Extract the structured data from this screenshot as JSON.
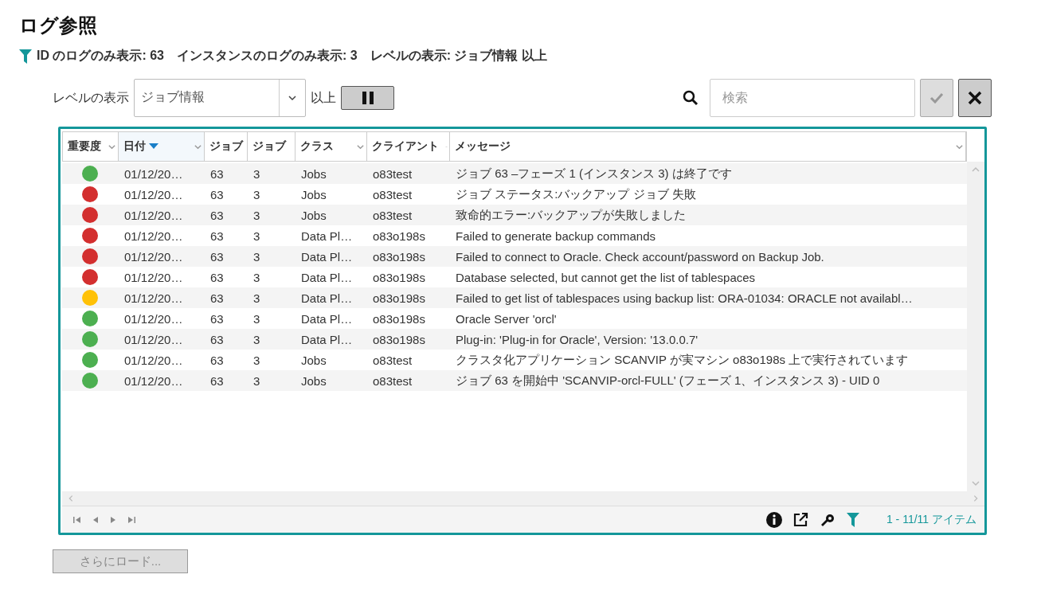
{
  "title": "ログ参照",
  "filter_summary": "ID のログのみ表示: 63　インスタンスのログのみ表示: 3　レベルの表示: ジョブ情報 以上",
  "level_filter": {
    "label": "レベルの表示",
    "value": "ジョブ情報",
    "suffix": "以上"
  },
  "search": {
    "placeholder": "検索"
  },
  "buttons": {
    "pause": {
      "disabled": false
    },
    "apply": {
      "disabled": true
    },
    "clear": {
      "disabled": false
    }
  },
  "table": {
    "columns": [
      {
        "label": "重要度",
        "sorted": false
      },
      {
        "label": "日付",
        "sorted": true
      },
      {
        "label": "ジョブ",
        "sorted": false
      },
      {
        "label": "ジョブ",
        "sorted": false
      },
      {
        "label": "クラス",
        "sorted": false
      },
      {
        "label": "クライアント",
        "sorted": false
      },
      {
        "label": "メッセージ",
        "sorted": false
      }
    ],
    "rows": [
      {
        "color": "#4caf50",
        "date": "01/12/20…",
        "job": "63",
        "instance": "3",
        "class": "Jobs",
        "client": "o83test",
        "message": "ジョブ 63 –フェーズ 1 (インスタンス 3) は終了です"
      },
      {
        "color": "#d32f2f",
        "date": "01/12/20…",
        "job": "63",
        "instance": "3",
        "class": "Jobs",
        "client": "o83test",
        "message": "ジョブ ステータス:バックアップ ジョブ 失敗"
      },
      {
        "color": "#d32f2f",
        "date": "01/12/20…",
        "job": "63",
        "instance": "3",
        "class": "Jobs",
        "client": "o83test",
        "message": "致命的エラー:バックアップが失敗しました"
      },
      {
        "color": "#d32f2f",
        "date": "01/12/20…",
        "job": "63",
        "instance": "3",
        "class": "Data Pl…",
        "client": "o83o198s",
        "message": "Failed to generate backup commands"
      },
      {
        "color": "#d32f2f",
        "date": "01/12/20…",
        "job": "63",
        "instance": "3",
        "class": "Data Pl…",
        "client": "o83o198s",
        "message": "Failed to connect to Oracle. Check account/password on Backup Job."
      },
      {
        "color": "#d32f2f",
        "date": "01/12/20…",
        "job": "63",
        "instance": "3",
        "class": "Data Pl…",
        "client": "o83o198s",
        "message": "Database selected, but cannot get the list of tablespaces"
      },
      {
        "color": "#ffc107",
        "date": "01/12/20…",
        "job": "63",
        "instance": "3",
        "class": "Data Pl…",
        "client": "o83o198s",
        "message": "Failed to get list of tablespaces using backup list: ORA-01034: ORACLE not availabl…"
      },
      {
        "color": "#4caf50",
        "date": "01/12/20…",
        "job": "63",
        "instance": "3",
        "class": "Data Pl…",
        "client": "o83o198s",
        "message": "Oracle Server 'orcl'"
      },
      {
        "color": "#4caf50",
        "date": "01/12/20…",
        "job": "63",
        "instance": "3",
        "class": "Data Pl…",
        "client": "o83o198s",
        "message": "Plug-in: 'Plug-in for Oracle', Version: '13.0.0.7'"
      },
      {
        "color": "#4caf50",
        "date": "01/12/20…",
        "job": "63",
        "instance": "3",
        "class": "Jobs",
        "client": "o83test",
        "message": "クラスタ化アプリケーション SCANVIP が実マシン o83o198s 上で実行されています"
      },
      {
        "color": "#4caf50",
        "date": "01/12/20…",
        "job": "63",
        "instance": "3",
        "class": "Jobs",
        "client": "o83test",
        "message": "ジョブ 63 を開始中 'SCANVIP-orcl-FULL' (フェーズ 1、インスタンス 3) - UID 0"
      }
    ]
  },
  "pager": {
    "count": "1 - 11/11 アイテム"
  },
  "load_more": {
    "label": "さらにロード...",
    "disabled": true
  }
}
